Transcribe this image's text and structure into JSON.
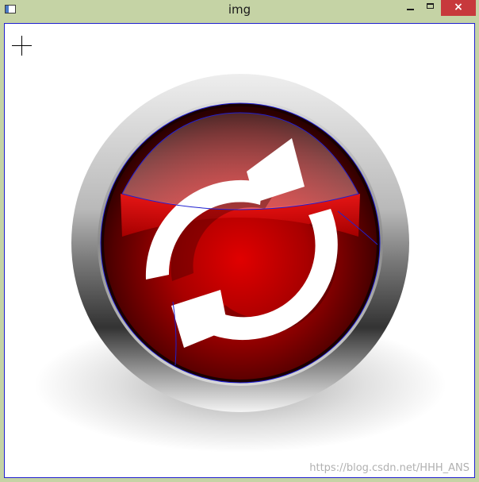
{
  "window": {
    "title": "img",
    "close_symbol": "×"
  },
  "icons": {
    "app": "app-window-icon",
    "cursor": "crosshair-icon",
    "refresh": "refresh-arrows-icon"
  },
  "colors": {
    "titlebar": "#c5d3a5",
    "close_button": "#c7393c",
    "button_red": "#cc0000",
    "contour_line": "#2020d0"
  },
  "watermark": "https://blog.csdn.net/HHH_ANS"
}
